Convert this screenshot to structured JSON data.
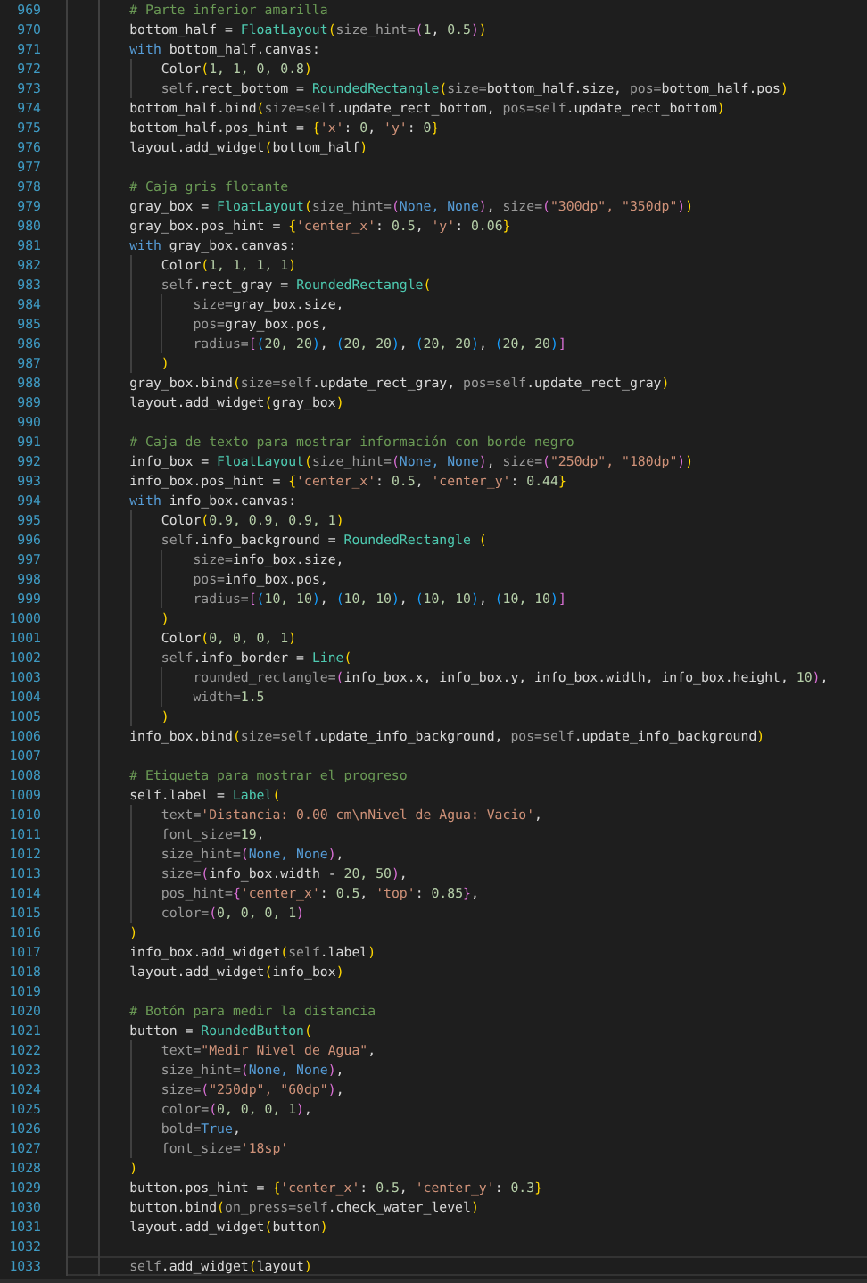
{
  "editor": {
    "lines": [
      {
        "n": "969",
        "current": false,
        "tokens": [
          {
            "text": "        # Parte inferior amarilla",
            "kind": "comment"
          }
        ]
      },
      {
        "n": "970",
        "current": false,
        "tokens": [
          {
            "text": "        bottom_half = ",
            "kind": "plain"
          },
          {
            "text": "FloatLayout",
            "kind": "type"
          },
          {
            "text": "(",
            "kind": "bracket1"
          },
          {
            "text": "size_hint=",
            "kind": "dim"
          },
          {
            "text": "(",
            "kind": "bracket2"
          },
          {
            "text": "1",
            "kind": "number"
          },
          {
            "text": ", ",
            "kind": "plain"
          },
          {
            "text": "0.5",
            "kind": "number"
          },
          {
            "text": ")",
            "kind": "bracket2"
          },
          {
            "text": ")",
            "kind": "bracket1"
          }
        ]
      },
      {
        "n": "971",
        "current": false,
        "tokens": [
          {
            "text": "        with",
            "kind": "keyword"
          },
          {
            "text": " bottom_half.canvas:",
            "kind": "plain"
          }
        ]
      },
      {
        "n": "972",
        "current": false,
        "tokens": [
          {
            "text": "            Color",
            "kind": "plain"
          },
          {
            "text": "(",
            "kind": "bracket1"
          },
          {
            "text": "1, 1, 0, 0.8",
            "kind": "number"
          },
          {
            "text": ")",
            "kind": "bracket1"
          }
        ]
      },
      {
        "n": "973",
        "current": false,
        "tokens": [
          {
            "text": "            self",
            "kind": "dim"
          },
          {
            "text": ".rect_bottom = ",
            "kind": "plain"
          },
          {
            "text": "RoundedRectangle",
            "kind": "type"
          },
          {
            "text": "(",
            "kind": "bracket1"
          },
          {
            "text": "size=",
            "kind": "dim"
          },
          {
            "text": "bottom_half.size, ",
            "kind": "plain"
          },
          {
            "text": "pos=",
            "kind": "dim"
          },
          {
            "text": "bottom_half.pos",
            "kind": "plain"
          },
          {
            "text": ")",
            "kind": "bracket1"
          }
        ]
      },
      {
        "n": "974",
        "current": false,
        "tokens": [
          {
            "text": "        bottom_half.bind",
            "kind": "plain"
          },
          {
            "text": "(",
            "kind": "bracket1"
          },
          {
            "text": "size=self",
            "kind": "dim"
          },
          {
            "text": ".update_rect_bottom, ",
            "kind": "plain"
          },
          {
            "text": "pos=self",
            "kind": "dim"
          },
          {
            "text": ".update_rect_bottom",
            "kind": "plain"
          },
          {
            "text": ")",
            "kind": "bracket1"
          }
        ]
      },
      {
        "n": "975",
        "current": false,
        "tokens": [
          {
            "text": "        bottom_half.pos_hint = ",
            "kind": "plain"
          },
          {
            "text": "{",
            "kind": "bracket1"
          },
          {
            "text": "'x'",
            "kind": "string"
          },
          {
            "text": ": ",
            "kind": "plain"
          },
          {
            "text": "0",
            "kind": "number"
          },
          {
            "text": ", ",
            "kind": "plain"
          },
          {
            "text": "'y'",
            "kind": "string"
          },
          {
            "text": ": ",
            "kind": "plain"
          },
          {
            "text": "0",
            "kind": "number"
          },
          {
            "text": "}",
            "kind": "bracket1"
          }
        ]
      },
      {
        "n": "976",
        "current": false,
        "tokens": [
          {
            "text": "        layout.add_widget",
            "kind": "plain"
          },
          {
            "text": "(",
            "kind": "bracket1"
          },
          {
            "text": "bottom_half",
            "kind": "plain"
          },
          {
            "text": ")",
            "kind": "bracket1"
          }
        ]
      },
      {
        "n": "977",
        "current": false
      },
      {
        "n": "978",
        "current": false,
        "tokens": [
          {
            "text": "        # Caja gris flotante",
            "kind": "comment"
          }
        ]
      },
      {
        "n": "979",
        "current": false,
        "tokens": [
          {
            "text": "        gray_box = ",
            "kind": "plain"
          },
          {
            "text": "FloatLayout",
            "kind": "type"
          },
          {
            "text": "(",
            "kind": "bracket1"
          },
          {
            "text": "size_hint=",
            "kind": "dim"
          },
          {
            "text": "(",
            "kind": "bracket2"
          },
          {
            "text": "None, None",
            "kind": "keyword"
          },
          {
            "text": ")",
            "kind": "bracket2"
          },
          {
            "text": ", ",
            "kind": "plain"
          },
          {
            "text": "size=",
            "kind": "dim"
          },
          {
            "text": "(",
            "kind": "bracket2"
          },
          {
            "text": "\"300dp\", \"350dp\"",
            "kind": "string"
          },
          {
            "text": ")",
            "kind": "bracket2"
          },
          {
            "text": ")",
            "kind": "bracket1"
          }
        ]
      },
      {
        "n": "980",
        "current": false,
        "tokens": [
          {
            "text": "        gray_box.pos_hint = ",
            "kind": "plain"
          },
          {
            "text": "{",
            "kind": "bracket1"
          },
          {
            "text": "'center_x'",
            "kind": "string"
          },
          {
            "text": ": ",
            "kind": "plain"
          },
          {
            "text": "0.5",
            "kind": "number"
          },
          {
            "text": ", ",
            "kind": "plain"
          },
          {
            "text": "'y'",
            "kind": "string"
          },
          {
            "text": ": ",
            "kind": "plain"
          },
          {
            "text": "0.06",
            "kind": "number"
          },
          {
            "text": "}",
            "kind": "bracket1"
          }
        ]
      },
      {
        "n": "981",
        "current": false,
        "tokens": [
          {
            "text": "        with",
            "kind": "keyword"
          },
          {
            "text": " gray_box.canvas:",
            "kind": "plain"
          }
        ]
      },
      {
        "n": "982",
        "current": false,
        "tokens": [
          {
            "text": "            Color",
            "kind": "plain"
          },
          {
            "text": "(",
            "kind": "bracket1"
          },
          {
            "text": "1, 1, 1, 1",
            "kind": "number"
          },
          {
            "text": ")",
            "kind": "bracket1"
          }
        ]
      },
      {
        "n": "983",
        "current": false,
        "tokens": [
          {
            "text": "            self",
            "kind": "dim"
          },
          {
            "text": ".rect_gray = ",
            "kind": "plain"
          },
          {
            "text": "RoundedRectangle",
            "kind": "type"
          },
          {
            "text": "(",
            "kind": "bracket1"
          }
        ]
      },
      {
        "n": "984",
        "current": false,
        "tokens": [
          {
            "text": "                size=",
            "kind": "dim"
          },
          {
            "text": "gray_box.size,",
            "kind": "plain"
          }
        ]
      },
      {
        "n": "985",
        "current": false,
        "tokens": [
          {
            "text": "                pos=",
            "kind": "dim"
          },
          {
            "text": "gray_box.pos,",
            "kind": "plain"
          }
        ]
      },
      {
        "n": "986",
        "current": false,
        "tokens": [
          {
            "text": "                radius=",
            "kind": "dim"
          },
          {
            "text": "[",
            "kind": "bracket2"
          },
          {
            "text": "(",
            "kind": "bracket3"
          },
          {
            "text": "20, 20",
            "kind": "number"
          },
          {
            "text": ")",
            "kind": "bracket3"
          },
          {
            "text": ", ",
            "kind": "plain"
          },
          {
            "text": "(",
            "kind": "bracket3"
          },
          {
            "text": "20, 20",
            "kind": "number"
          },
          {
            "text": ")",
            "kind": "bracket3"
          },
          {
            "text": ", ",
            "kind": "plain"
          },
          {
            "text": "(",
            "kind": "bracket3"
          },
          {
            "text": "20, 20",
            "kind": "number"
          },
          {
            "text": ")",
            "kind": "bracket3"
          },
          {
            "text": ", ",
            "kind": "plain"
          },
          {
            "text": "(",
            "kind": "bracket3"
          },
          {
            "text": "20, 20",
            "kind": "number"
          },
          {
            "text": ")",
            "kind": "bracket3"
          },
          {
            "text": "]",
            "kind": "bracket2"
          }
        ]
      },
      {
        "n": "987",
        "current": false,
        "tokens": [
          {
            "text": "            )",
            "kind": "bracket1"
          }
        ]
      },
      {
        "n": "988",
        "current": false,
        "tokens": [
          {
            "text": "        gray_box.bind",
            "kind": "plain"
          },
          {
            "text": "(",
            "kind": "bracket1"
          },
          {
            "text": "size=self",
            "kind": "dim"
          },
          {
            "text": ".update_rect_gray, ",
            "kind": "plain"
          },
          {
            "text": "pos=self",
            "kind": "dim"
          },
          {
            "text": ".update_rect_gray",
            "kind": "plain"
          },
          {
            "text": ")",
            "kind": "bracket1"
          }
        ]
      },
      {
        "n": "989",
        "current": false,
        "tokens": [
          {
            "text": "        layout.add_widget",
            "kind": "plain"
          },
          {
            "text": "(",
            "kind": "bracket1"
          },
          {
            "text": "gray_box",
            "kind": "plain"
          },
          {
            "text": ")",
            "kind": "bracket1"
          }
        ]
      },
      {
        "n": "990",
        "current": false
      },
      {
        "n": "991",
        "current": false,
        "tokens": [
          {
            "text": "        # Caja de texto para mostrar información con borde negro",
            "kind": "comment"
          }
        ]
      },
      {
        "n": "992",
        "current": false,
        "tokens": [
          {
            "text": "        info_box = ",
            "kind": "plain"
          },
          {
            "text": "FloatLayout",
            "kind": "type"
          },
          {
            "text": "(",
            "kind": "bracket1"
          },
          {
            "text": "size_hint=",
            "kind": "dim"
          },
          {
            "text": "(",
            "kind": "bracket2"
          },
          {
            "text": "None, None",
            "kind": "keyword"
          },
          {
            "text": ")",
            "kind": "bracket2"
          },
          {
            "text": ", ",
            "kind": "plain"
          },
          {
            "text": "size=",
            "kind": "dim"
          },
          {
            "text": "(",
            "kind": "bracket2"
          },
          {
            "text": "\"250dp\", \"180dp\"",
            "kind": "string"
          },
          {
            "text": ")",
            "kind": "bracket2"
          },
          {
            "text": ")",
            "kind": "bracket1"
          }
        ]
      },
      {
        "n": "993",
        "current": false,
        "tokens": [
          {
            "text": "        info_box.pos_hint = ",
            "kind": "plain"
          },
          {
            "text": "{",
            "kind": "bracket1"
          },
          {
            "text": "'center_x'",
            "kind": "string"
          },
          {
            "text": ": ",
            "kind": "plain"
          },
          {
            "text": "0.5",
            "kind": "number"
          },
          {
            "text": ", ",
            "kind": "plain"
          },
          {
            "text": "'center_y'",
            "kind": "string"
          },
          {
            "text": ": ",
            "kind": "plain"
          },
          {
            "text": "0.44",
            "kind": "number"
          },
          {
            "text": "}",
            "kind": "bracket1"
          }
        ]
      },
      {
        "n": "994",
        "current": false,
        "tokens": [
          {
            "text": "        with",
            "kind": "keyword"
          },
          {
            "text": " info_box.canvas:",
            "kind": "plain"
          }
        ]
      },
      {
        "n": "995",
        "current": false,
        "tokens": [
          {
            "text": "            Color",
            "kind": "plain"
          },
          {
            "text": "(",
            "kind": "bracket1"
          },
          {
            "text": "0.9, 0.9, 0.9, 1",
            "kind": "number"
          },
          {
            "text": ")",
            "kind": "bracket1"
          }
        ]
      },
      {
        "n": "996",
        "current": false,
        "tokens": [
          {
            "text": "            self",
            "kind": "dim"
          },
          {
            "text": ".info_background = ",
            "kind": "plain"
          },
          {
            "text": "RoundedRectangle",
            "kind": "type"
          },
          {
            "text": " (",
            "kind": "bracket1"
          }
        ]
      },
      {
        "n": "997",
        "current": false,
        "tokens": [
          {
            "text": "                size=",
            "kind": "dim"
          },
          {
            "text": "info_box.size,",
            "kind": "plain"
          }
        ]
      },
      {
        "n": "998",
        "current": false,
        "tokens": [
          {
            "text": "                pos=",
            "kind": "dim"
          },
          {
            "text": "info_box.pos,",
            "kind": "plain"
          }
        ]
      },
      {
        "n": "999",
        "current": false,
        "tokens": [
          {
            "text": "                radius=",
            "kind": "dim"
          },
          {
            "text": "[",
            "kind": "bracket2"
          },
          {
            "text": "(",
            "kind": "bracket3"
          },
          {
            "text": "10, 10",
            "kind": "number"
          },
          {
            "text": ")",
            "kind": "bracket3"
          },
          {
            "text": ", ",
            "kind": "plain"
          },
          {
            "text": "(",
            "kind": "bracket3"
          },
          {
            "text": "10, 10",
            "kind": "number"
          },
          {
            "text": ")",
            "kind": "bracket3"
          },
          {
            "text": ", ",
            "kind": "plain"
          },
          {
            "text": "(",
            "kind": "bracket3"
          },
          {
            "text": "10, 10",
            "kind": "number"
          },
          {
            "text": ")",
            "kind": "bracket3"
          },
          {
            "text": ", ",
            "kind": "plain"
          },
          {
            "text": "(",
            "kind": "bracket3"
          },
          {
            "text": "10, 10",
            "kind": "number"
          },
          {
            "text": ")",
            "kind": "bracket3"
          },
          {
            "text": "]",
            "kind": "bracket2"
          }
        ]
      },
      {
        "n": "1000",
        "current": false,
        "tokens": [
          {
            "text": "            )",
            "kind": "bracket1"
          }
        ]
      },
      {
        "n": "1001",
        "current": false,
        "tokens": [
          {
            "text": "            Color",
            "kind": "plain"
          },
          {
            "text": "(",
            "kind": "bracket1"
          },
          {
            "text": "0, 0, 0, 1",
            "kind": "number"
          },
          {
            "text": ")",
            "kind": "bracket1"
          }
        ]
      },
      {
        "n": "1002",
        "current": false,
        "tokens": [
          {
            "text": "            self",
            "kind": "dim"
          },
          {
            "text": ".info_border = ",
            "kind": "plain"
          },
          {
            "text": "Line",
            "kind": "type"
          },
          {
            "text": "(",
            "kind": "bracket1"
          }
        ]
      },
      {
        "n": "1003",
        "current": false,
        "tokens": [
          {
            "text": "                rounded_rectangle=",
            "kind": "dim"
          },
          {
            "text": "(",
            "kind": "bracket2"
          },
          {
            "text": "info_box.x, info_box.y, info_box.width, info_box.height, ",
            "kind": "plain"
          },
          {
            "text": "10",
            "kind": "number"
          },
          {
            "text": ")",
            "kind": "bracket2"
          },
          {
            "text": ",",
            "kind": "plain"
          }
        ]
      },
      {
        "n": "1004",
        "current": false,
        "tokens": [
          {
            "text": "                width=",
            "kind": "dim"
          },
          {
            "text": "1.5",
            "kind": "number"
          }
        ]
      },
      {
        "n": "1005",
        "current": false,
        "tokens": [
          {
            "text": "            )",
            "kind": "bracket1"
          }
        ]
      },
      {
        "n": "1006",
        "current": false,
        "tokens": [
          {
            "text": "        info_box.bind",
            "kind": "plain"
          },
          {
            "text": "(",
            "kind": "bracket1"
          },
          {
            "text": "size=self",
            "kind": "dim"
          },
          {
            "text": ".update_info_background, ",
            "kind": "plain"
          },
          {
            "text": "pos=self",
            "kind": "dim"
          },
          {
            "text": ".update_info_background",
            "kind": "plain"
          },
          {
            "text": ")",
            "kind": "bracket1"
          }
        ]
      },
      {
        "n": "1007",
        "current": false
      },
      {
        "n": "1008",
        "current": false,
        "tokens": [
          {
            "text": "        # Etiqueta para mostrar el progreso",
            "kind": "comment"
          }
        ]
      },
      {
        "n": "1009",
        "current": false,
        "tokens": [
          {
            "text": "        self.label = ",
            "kind": "plain"
          },
          {
            "text": "Label",
            "kind": "type"
          },
          {
            "text": "(",
            "kind": "bracket1"
          }
        ]
      },
      {
        "n": "1010",
        "current": false,
        "tokens": [
          {
            "text": "            text=",
            "kind": "dim"
          },
          {
            "text": "'Distancia: 0.00 cm\\nNivel de Agua: Vacio'",
            "kind": "string"
          },
          {
            "text": ",",
            "kind": "plain"
          }
        ]
      },
      {
        "n": "1011",
        "current": false,
        "tokens": [
          {
            "text": "            font_size=",
            "kind": "dim"
          },
          {
            "text": "19",
            "kind": "number"
          },
          {
            "text": ",",
            "kind": "plain"
          }
        ]
      },
      {
        "n": "1012",
        "current": false,
        "tokens": [
          {
            "text": "            size_hint=",
            "kind": "dim"
          },
          {
            "text": "(",
            "kind": "bracket2"
          },
          {
            "text": "None, None",
            "kind": "keyword"
          },
          {
            "text": ")",
            "kind": "bracket2"
          },
          {
            "text": ",",
            "kind": "plain"
          }
        ]
      },
      {
        "n": "1013",
        "current": false,
        "tokens": [
          {
            "text": "            size=",
            "kind": "dim"
          },
          {
            "text": "(",
            "kind": "bracket2"
          },
          {
            "text": "info_box.width - ",
            "kind": "plain"
          },
          {
            "text": "20, 50",
            "kind": "number"
          },
          {
            "text": ")",
            "kind": "bracket2"
          },
          {
            "text": ",",
            "kind": "plain"
          }
        ]
      },
      {
        "n": "1014",
        "current": false,
        "tokens": [
          {
            "text": "            pos_hint=",
            "kind": "dim"
          },
          {
            "text": "{",
            "kind": "bracket2"
          },
          {
            "text": "'center_x'",
            "kind": "string"
          },
          {
            "text": ": ",
            "kind": "plain"
          },
          {
            "text": "0.5",
            "kind": "number"
          },
          {
            "text": ", ",
            "kind": "plain"
          },
          {
            "text": "'top'",
            "kind": "string"
          },
          {
            "text": ": ",
            "kind": "plain"
          },
          {
            "text": "0.85",
            "kind": "number"
          },
          {
            "text": "}",
            "kind": "bracket2"
          },
          {
            "text": ",",
            "kind": "plain"
          }
        ]
      },
      {
        "n": "1015",
        "current": false,
        "tokens": [
          {
            "text": "            color=",
            "kind": "dim"
          },
          {
            "text": "(",
            "kind": "bracket2"
          },
          {
            "text": "0, 0, 0, 1",
            "kind": "number"
          },
          {
            "text": ")",
            "kind": "bracket2"
          }
        ]
      },
      {
        "n": "1016",
        "current": false,
        "tokens": [
          {
            "text": "        )",
            "kind": "bracket1"
          }
        ]
      },
      {
        "n": "1017",
        "current": false,
        "tokens": [
          {
            "text": "        info_box.add_widget",
            "kind": "plain"
          },
          {
            "text": "(",
            "kind": "bracket1"
          },
          {
            "text": "self",
            "kind": "dim"
          },
          {
            "text": ".label",
            "kind": "plain"
          },
          {
            "text": ")",
            "kind": "bracket1"
          }
        ]
      },
      {
        "n": "1018",
        "current": false,
        "tokens": [
          {
            "text": "        layout.add_widget",
            "kind": "plain"
          },
          {
            "text": "(",
            "kind": "bracket1"
          },
          {
            "text": "info_box",
            "kind": "plain"
          },
          {
            "text": ")",
            "kind": "bracket1"
          }
        ]
      },
      {
        "n": "1019",
        "current": false
      },
      {
        "n": "1020",
        "current": false,
        "tokens": [
          {
            "text": "        # Botón para medir la distancia",
            "kind": "comment"
          }
        ]
      },
      {
        "n": "1021",
        "current": false,
        "tokens": [
          {
            "text": "        button = ",
            "kind": "plain"
          },
          {
            "text": "RoundedButton",
            "kind": "type"
          },
          {
            "text": "(",
            "kind": "bracket1"
          }
        ]
      },
      {
        "n": "1022",
        "current": false,
        "tokens": [
          {
            "text": "            text=",
            "kind": "dim"
          },
          {
            "text": "\"Medir Nivel de Agua\"",
            "kind": "string"
          },
          {
            "text": ",",
            "kind": "plain"
          }
        ]
      },
      {
        "n": "1023",
        "current": false,
        "tokens": [
          {
            "text": "            size_hint=",
            "kind": "dim"
          },
          {
            "text": "(",
            "kind": "bracket2"
          },
          {
            "text": "None, None",
            "kind": "keyword"
          },
          {
            "text": ")",
            "kind": "bracket2"
          },
          {
            "text": ",",
            "kind": "plain"
          }
        ]
      },
      {
        "n": "1024",
        "current": false,
        "tokens": [
          {
            "text": "            size=",
            "kind": "dim"
          },
          {
            "text": "(",
            "kind": "bracket2"
          },
          {
            "text": "\"250dp\", \"60dp\"",
            "kind": "string"
          },
          {
            "text": ")",
            "kind": "bracket2"
          },
          {
            "text": ",",
            "kind": "plain"
          }
        ]
      },
      {
        "n": "1025",
        "current": false,
        "tokens": [
          {
            "text": "            color=",
            "kind": "dim"
          },
          {
            "text": "(",
            "kind": "bracket2"
          },
          {
            "text": "0, 0, 0, 1",
            "kind": "number"
          },
          {
            "text": ")",
            "kind": "bracket2"
          },
          {
            "text": ",",
            "kind": "plain"
          }
        ]
      },
      {
        "n": "1026",
        "current": false,
        "tokens": [
          {
            "text": "            bold=",
            "kind": "dim"
          },
          {
            "text": "True",
            "kind": "keyword"
          },
          {
            "text": ",",
            "kind": "plain"
          }
        ]
      },
      {
        "n": "1027",
        "current": false,
        "tokens": [
          {
            "text": "            font_size=",
            "kind": "dim"
          },
          {
            "text": "'18sp'",
            "kind": "string"
          }
        ]
      },
      {
        "n": "1028",
        "current": false,
        "tokens": [
          {
            "text": "        )",
            "kind": "bracket1"
          }
        ]
      },
      {
        "n": "1029",
        "current": false,
        "tokens": [
          {
            "text": "        button.pos_hint = ",
            "kind": "plain"
          },
          {
            "text": "{",
            "kind": "bracket1"
          },
          {
            "text": "'center_x'",
            "kind": "string"
          },
          {
            "text": ": ",
            "kind": "plain"
          },
          {
            "text": "0.5",
            "kind": "number"
          },
          {
            "text": ", ",
            "kind": "plain"
          },
          {
            "text": "'center_y'",
            "kind": "string"
          },
          {
            "text": ": ",
            "kind": "plain"
          },
          {
            "text": "0.3",
            "kind": "number"
          },
          {
            "text": "}",
            "kind": "bracket1"
          }
        ]
      },
      {
        "n": "1030",
        "current": false,
        "tokens": [
          {
            "text": "        button.bind",
            "kind": "plain"
          },
          {
            "text": "(",
            "kind": "bracket1"
          },
          {
            "text": "on_press=self",
            "kind": "dim"
          },
          {
            "text": ".check_water_level",
            "kind": "plain"
          },
          {
            "text": ")",
            "kind": "bracket1"
          }
        ]
      },
      {
        "n": "1031",
        "current": false,
        "tokens": [
          {
            "text": "        layout.add_widget",
            "kind": "plain"
          },
          {
            "text": "(",
            "kind": "bracket1"
          },
          {
            "text": "button",
            "kind": "plain"
          },
          {
            "text": ")",
            "kind": "bracket1"
          }
        ]
      },
      {
        "n": "1032",
        "current": false
      },
      {
        "n": "1033",
        "current": true,
        "tokens": [
          {
            "text": "        self",
            "kind": "dim"
          },
          {
            "text": ".add_widget",
            "kind": "plain"
          },
          {
            "text": "(",
            "kind": "bracket1"
          },
          {
            "text": "layout",
            "kind": "plain"
          },
          {
            "text": ")",
            "kind": "bracket1"
          }
        ]
      }
    ]
  }
}
